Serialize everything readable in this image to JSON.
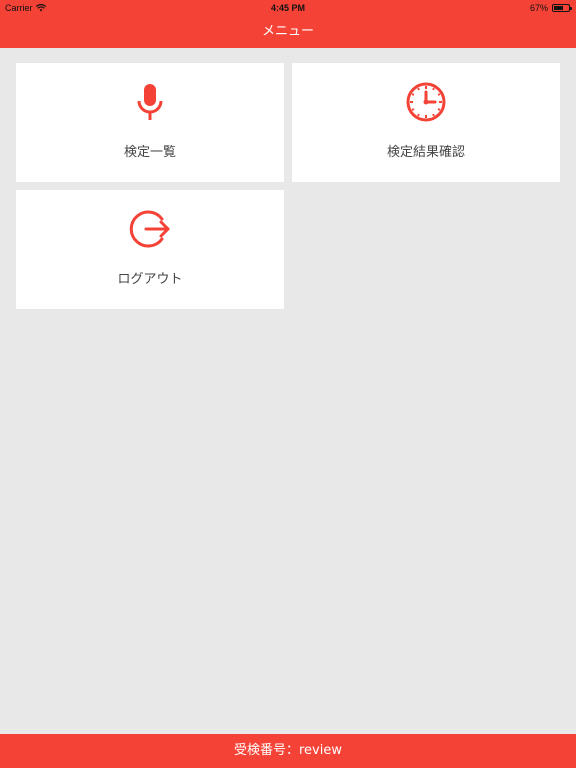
{
  "status_bar": {
    "carrier": "Carrier",
    "time": "4:45 PM",
    "battery_percent_label": "67%",
    "battery_level": 0.67
  },
  "nav": {
    "title": "メニュー"
  },
  "menu": {
    "items": [
      {
        "label": "検定一覧",
        "icon": "microphone-icon"
      },
      {
        "label": "検定結果確認",
        "icon": "clock-icon"
      },
      {
        "label": "ログアウト",
        "icon": "logout-icon"
      }
    ]
  },
  "footer": {
    "text": "受検番号：review"
  },
  "colors": {
    "accent": "#f44336",
    "background": "#e8e8e8",
    "tile": "#ffffff"
  }
}
